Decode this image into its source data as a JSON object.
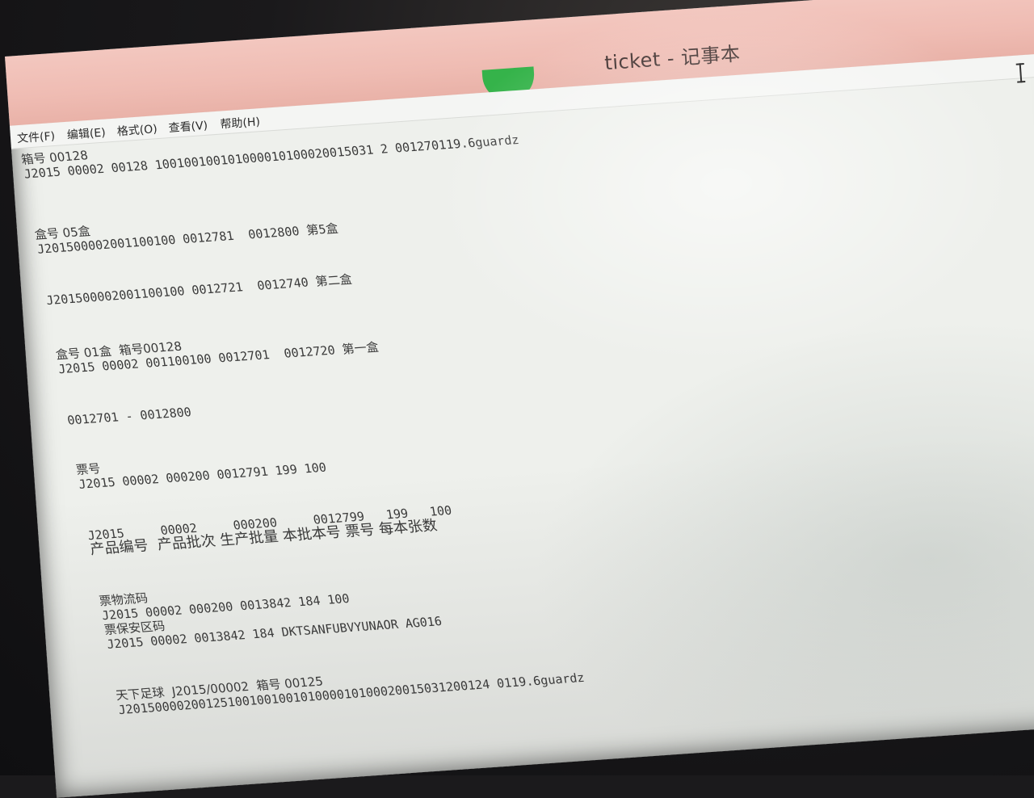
{
  "window": {
    "title": "ticket - 记事本"
  },
  "menu": [
    {
      "label": "文件(F)"
    },
    {
      "label": "编辑(E)"
    },
    {
      "label": "格式(O)"
    },
    {
      "label": "查看(V)"
    },
    {
      "label": "帮助(H)"
    }
  ],
  "lines": [
    "箱号 00128",
    "J2015 00002 00128 100100100101000010100020015031 2 001270119.6guardz",
    "盒号 05盒",
    "J201500002001100100 0012781  0012800 第5盒",
    "J201500002001100100 0012721  0012740 第二盒",
    "盒号 01盒  箱号00128",
    "J2015 00002 001100100 0012701  0012720 第一盒",
    "0012701 - 0012800",
    "票号",
    "J2015 00002 000200 0012791 199 100",
    "J2015     00002     000200     0012799   199   100",
    "产品编号  产品批次 生产批量 本批本号 票号 每本张数",
    "票物流码",
    "J2015 00002 000200 0013842 184 100",
    "票保安区码",
    "J2015 00002 0013842 184 DKTSANFUBVYUNAOR AG016",
    "天下足球  J2015/00002  箱号 00125",
    "J20150000200125100100100101000010100020015031200124 0119.6guardz"
  ]
}
